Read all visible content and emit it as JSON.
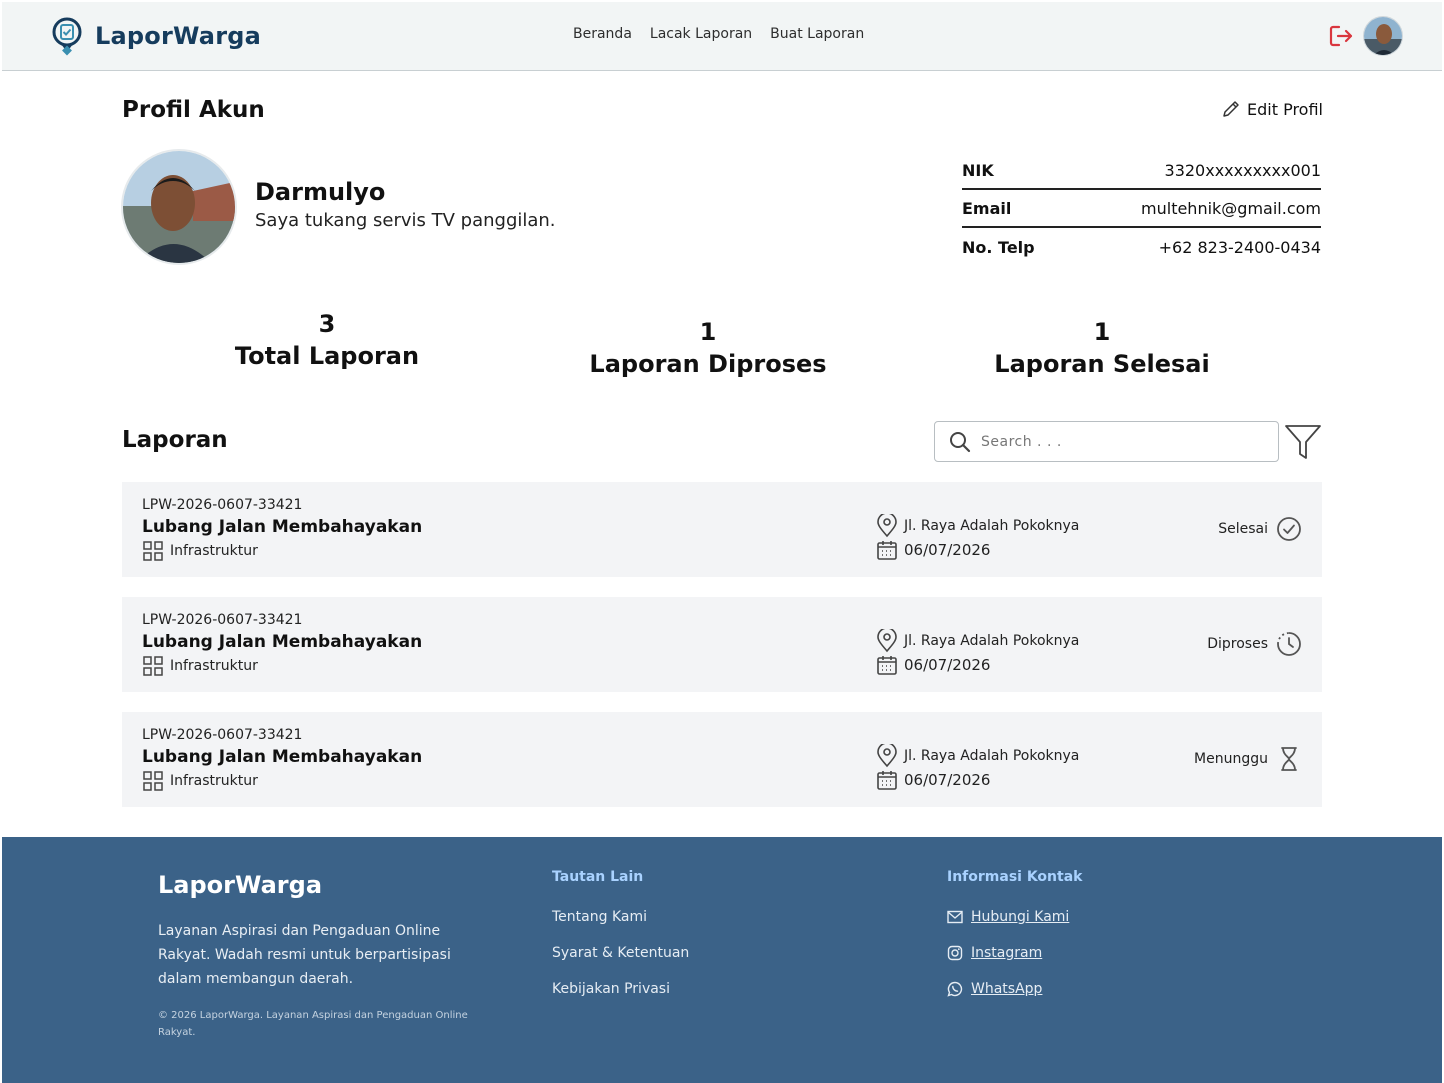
{
  "header": {
    "brand": "LaporWarga",
    "nav": [
      "Beranda",
      "Lacak Laporan",
      "Buat Laporan"
    ],
    "accent_color": "#163c5d",
    "logout_color": "#d9363e"
  },
  "profile": {
    "section_title": "Profil Akun",
    "edit_label": "Edit Profil",
    "name": "Darmulyo",
    "bio": "Saya tukang servis TV panggilan.",
    "info": [
      {
        "label": "NIK",
        "value": "3320xxxxxxxxx001"
      },
      {
        "label": "Email",
        "value": "multehnik@gmail.com"
      },
      {
        "label": "No. Telp",
        "value": "+62 823-2400-0434"
      }
    ]
  },
  "stats": [
    {
      "value": "3",
      "label": "Total Laporan"
    },
    {
      "value": "1",
      "label": "Laporan Diproses"
    },
    {
      "value": "1",
      "label": "Laporan Selesai"
    }
  ],
  "reports": {
    "section_title": "Laporan",
    "search_placeholder": "Search . . .",
    "items": [
      {
        "id": "LPW-2026-0607-33421",
        "title": "Lubang Jalan Membahayakan",
        "category": "Infrastruktur",
        "location": "Jl. Raya Adalah Pokoknya",
        "date": "06/07/2026",
        "status": "Selesai",
        "status_icon": "check-circle-icon"
      },
      {
        "id": "LPW-2026-0607-33421",
        "title": "Lubang Jalan Membahayakan",
        "category": "Infrastruktur",
        "location": "Jl. Raya Adalah Pokoknya",
        "date": "06/07/2026",
        "status": "Diproses",
        "status_icon": "clock-progress-icon"
      },
      {
        "id": "LPW-2026-0607-33421",
        "title": "Lubang Jalan Membahayakan",
        "category": "Infrastruktur",
        "location": "Jl. Raya Adalah Pokoknya",
        "date": "06/07/2026",
        "status": "Menunggu",
        "status_icon": "hourglass-icon"
      }
    ]
  },
  "footer": {
    "brand": "LaporWarga",
    "description": "Layanan Aspirasi dan Pengaduan Online Rakyat. Wadah resmi untuk berpartisipasi dalam membangun daerah.",
    "copyright": "© 2026 LaporWarga. Layanan Aspirasi dan Pengaduan Online Rakyat.",
    "links_title": "Tautan Lain",
    "links": [
      "Tentang Kami",
      "Syarat & Ketentuan",
      "Kebijakan Privasi"
    ],
    "contact_title": "Informasi Kontak",
    "contacts": [
      "Hubungi Kami",
      "Instagram",
      "WhatsApp"
    ],
    "background_color": "#3b6288"
  }
}
